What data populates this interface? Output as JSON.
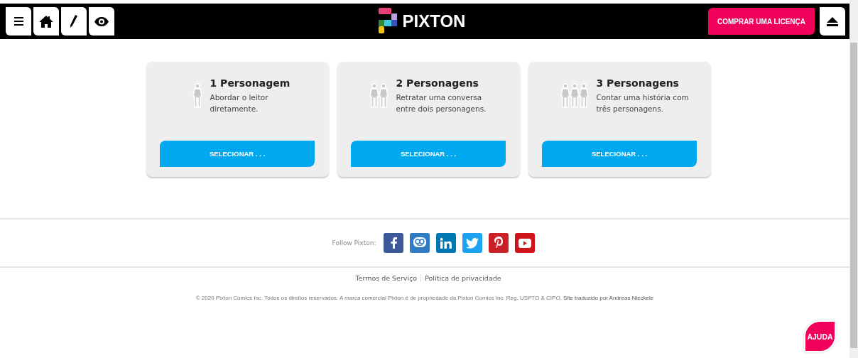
{
  "header": {
    "logo": "PIXTON",
    "buy_button": "COMPRAR UMA LICENÇA"
  },
  "cards": [
    {
      "kind": "one",
      "title": "1 Personagem",
      "description": "Abordar o leitor diretamente.",
      "button": "SELECIONAR . . ."
    },
    {
      "kind": "two",
      "title": "2 Personagens",
      "description": "Retratar uma conversa entre dois personagens.",
      "button": "SELECIONAR . . ."
    },
    {
      "kind": "three",
      "title": "3 Personagens",
      "description": "Contar uma história com três personagens.",
      "button": "SELECIONAR . . ."
    }
  ],
  "footer": {
    "follow_label": "Follow Pixton:",
    "social": [
      {
        "kind": "facebook",
        "color": "#3b5998"
      },
      {
        "kind": "edmodo",
        "color": "#2f7bc4"
      },
      {
        "kind": "linkedin",
        "color": "#0077b5"
      },
      {
        "kind": "twitter",
        "color": "#1da1f2"
      },
      {
        "kind": "pinterest",
        "color": "#cb2027"
      },
      {
        "kind": "youtube",
        "color": "#d0141c"
      }
    ],
    "links": [
      "Termos de Serviço",
      "Política de privacidade"
    ],
    "copyright": "© 2020 Pixton Comics Inc. Todos os direitos reservados. A marca comercial Pixton é de propriedade da Pixton Comics Inc. Reg. USPTO & CIPO. **Site traduzido por Andreas Nieckele**"
  },
  "help_button": "AJUDA"
}
